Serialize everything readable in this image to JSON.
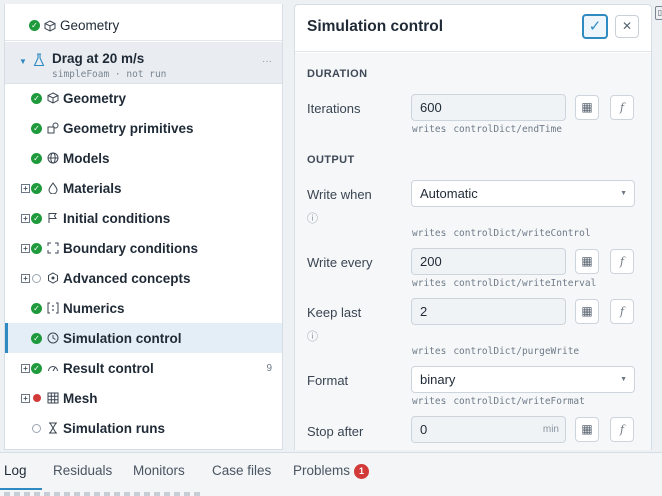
{
  "tree": {
    "top_item": {
      "label": "Geometry"
    },
    "study": {
      "title": "Drag at 20 m/s",
      "subtitle": "simpleFoam · not run",
      "menu": "···"
    },
    "items": [
      {
        "label": "Geometry",
        "icon": "cube-icon",
        "status": "ok",
        "expandable": false
      },
      {
        "label": "Geometry primitives",
        "icon": "shapes-icon",
        "status": "ok",
        "expandable": false
      },
      {
        "label": "Models",
        "icon": "globe-icon",
        "status": "ok",
        "expandable": false
      },
      {
        "label": "Materials",
        "icon": "drop-icon",
        "status": "ok",
        "expandable": true
      },
      {
        "label": "Initial conditions",
        "icon": "flag-icon",
        "status": "ok",
        "expandable": true
      },
      {
        "label": "Boundary conditions",
        "icon": "boundary-icon",
        "status": "ok",
        "expandable": true
      },
      {
        "label": "Advanced concepts",
        "icon": "hexagon-icon",
        "status": "open",
        "expandable": true
      },
      {
        "label": "Numerics",
        "icon": "numerics-icon",
        "status": "ok",
        "expandable": false
      },
      {
        "label": "Simulation control",
        "icon": "clock-icon",
        "status": "ok",
        "expandable": false,
        "selected": true
      },
      {
        "label": "Result control",
        "icon": "gauge-icon",
        "status": "ok",
        "expandable": true,
        "count": "9"
      },
      {
        "label": "Mesh",
        "icon": "grid-icon",
        "status": "error",
        "expandable": true
      },
      {
        "label": "Simulation runs",
        "icon": "runs-icon",
        "status": "open",
        "expandable": false
      }
    ]
  },
  "panel": {
    "title": "Simulation control",
    "confirm": "✓",
    "close": "✕",
    "writes_word": "writes",
    "info_glyph": "ⓘ",
    "duration": {
      "heading": "DURATION",
      "iterations": {
        "label": "Iterations",
        "value": "600",
        "target": "controlDict/endTime"
      }
    },
    "output": {
      "heading": "OUTPUT",
      "write_when": {
        "label": "Write when",
        "value": "Automatic",
        "target": "controlDict/writeControl"
      },
      "write_every": {
        "label": "Write every",
        "value": "200",
        "target": "controlDict/writeInterval"
      },
      "keep_last": {
        "label": "Keep last",
        "value": "2",
        "target": "controlDict/purgeWrite"
      },
      "format": {
        "label": "Format",
        "value": "binary",
        "target": "controlDict/writeFormat"
      },
      "stop_after": {
        "label": "Stop after",
        "value": "0",
        "unit": "min"
      }
    }
  },
  "bottom_tabs": {
    "log": "Log",
    "residuals": "Residuals",
    "monitors": "Monitors",
    "case_files": "Case files",
    "problems": "Problems",
    "problems_count": "1"
  },
  "colors": {
    "accent": "#2e8ac0",
    "ok": "#1e9a3c",
    "error": "#d23a3a"
  }
}
